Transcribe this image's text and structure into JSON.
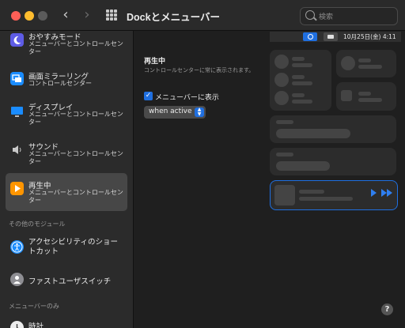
{
  "window": {
    "title": "Dockとメニューバー"
  },
  "search": {
    "placeholder": "検索"
  },
  "sidebar": {
    "items": [
      {
        "title": "おやすみモード",
        "subtitle": "メニューバーとコントロールセンター",
        "icon": "moon-icon",
        "color": "#5e5ce6"
      },
      {
        "title": "画面ミラーリング",
        "subtitle": "コントロールセンター",
        "icon": "screen-mirroring-icon",
        "color": "#1a8cff"
      },
      {
        "title": "ディスプレイ",
        "subtitle": "メニューバーとコントロールセンター",
        "icon": "display-icon",
        "color": "#1a8cff"
      },
      {
        "title": "サウンド",
        "subtitle": "メニューバーとコントロールセンター",
        "icon": "speaker-icon",
        "color": "#8e8e93"
      },
      {
        "title": "再生中",
        "subtitle": "メニューバーとコントロールセンター",
        "icon": "play-icon",
        "color": "#ff9500"
      }
    ],
    "section_other": "その他のモジュール",
    "other_items": [
      {
        "title": "アクセシビリティのショートカット",
        "icon": "accessibility-icon",
        "color": "#1a8cff"
      },
      {
        "title": "ファストユーザスイッチ",
        "icon": "user-switch-icon",
        "color": "#8e8e93"
      }
    ],
    "section_menubar": "メニューバーのみ",
    "menubar_items": [
      {
        "title": "時計",
        "icon": "clock-icon"
      }
    ]
  },
  "main": {
    "title": "再生中",
    "description": "コントロールセンターに常に表示されます。",
    "checkbox_label": "メニューバーに表示",
    "checkbox_checked": true,
    "popup_value": "when active"
  },
  "preview": {
    "menubar_date": "10月25日(金)  4:11"
  },
  "help": {
    "label": "?"
  }
}
